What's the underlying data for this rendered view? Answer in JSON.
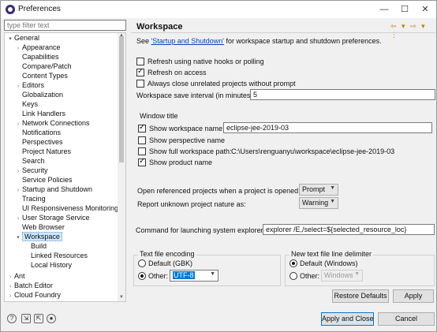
{
  "window": {
    "title": "Preferences",
    "minimize": "—",
    "maximize": "☐",
    "close": "✕"
  },
  "filter": {
    "placeholder": "type filter text"
  },
  "tree": {
    "items": [
      {
        "label": "General",
        "arrow": "▾"
      },
      {
        "label": "Appearance",
        "arrow": "›"
      },
      {
        "label": "Capabilities",
        "arrow": ""
      },
      {
        "label": "Compare/Patch",
        "arrow": ""
      },
      {
        "label": "Content Types",
        "arrow": ""
      },
      {
        "label": "Editors",
        "arrow": "›"
      },
      {
        "label": "Globalization",
        "arrow": ""
      },
      {
        "label": "Keys",
        "arrow": ""
      },
      {
        "label": "Link Handlers",
        "arrow": ""
      },
      {
        "label": "Network Connections",
        "arrow": "›"
      },
      {
        "label": "Notifications",
        "arrow": ""
      },
      {
        "label": "Perspectives",
        "arrow": ""
      },
      {
        "label": "Project Natures",
        "arrow": ""
      },
      {
        "label": "Search",
        "arrow": ""
      },
      {
        "label": "Security",
        "arrow": "›"
      },
      {
        "label": "Service Policies",
        "arrow": ""
      },
      {
        "label": "Startup and Shutdown",
        "arrow": "›"
      },
      {
        "label": "Tracing",
        "arrow": ""
      },
      {
        "label": "UI Responsiveness Monitoring",
        "arrow": ""
      },
      {
        "label": "User Storage Service",
        "arrow": "›"
      },
      {
        "label": "Web Browser",
        "arrow": ""
      },
      {
        "label": "Workspace",
        "arrow": "▾"
      },
      {
        "label": "Build",
        "arrow": ""
      },
      {
        "label": "Linked Resources",
        "arrow": ""
      },
      {
        "label": "Local History",
        "arrow": ""
      },
      {
        "label": "Ant",
        "arrow": "›"
      },
      {
        "label": "Batch Editor",
        "arrow": "›"
      },
      {
        "label": "Cloud Foundry",
        "arrow": "›"
      }
    ]
  },
  "page": {
    "title": "Workspace",
    "nav_arrows": "⇦ ▾ ⇨ ▾ ⋮",
    "intro_prefix": "See ",
    "intro_link": "'Startup and Shutdown'",
    "intro_suffix": " for workspace startup and shutdown preferences.",
    "refresh_native": "Refresh using native hooks or polling",
    "refresh_access": "Refresh on access",
    "close_unrelated": "Always close unrelated projects without prompt",
    "save_interval_label": "Workspace save interval (in minutes):",
    "save_interval_value": "5",
    "window_title_group": "Window title",
    "show_ws_name": "Show workspace name:",
    "ws_name_value": "eclipse-jee-2019-03",
    "show_perspective": "Show perspective name",
    "show_full_path": "Show full workspace path:",
    "full_path_value": "C:\\Users\\renguanyu\\workspace\\eclipse-jee-2019-03",
    "show_product": "Show product name",
    "open_ref_label": "Open referenced projects when a project is opened:",
    "open_ref_value": "Prompt",
    "unknown_nature_label": "Report unknown project nature as:",
    "unknown_nature_value": "Warning",
    "sys_explorer_label": "Command for launching system explorer:",
    "sys_explorer_value": "explorer /E,/select=${selected_resource_loc}",
    "encoding_group": "Text file encoding",
    "encoding_default": "Default (GBK)",
    "encoding_other": "Other:",
    "encoding_value": "UTF-8",
    "delimiter_group": "New text file line delimiter",
    "delimiter_default": "Default (Windows)",
    "delimiter_other": "Other:",
    "delimiter_value": "Windows"
  },
  "buttons": {
    "restore_defaults": "Restore Defaults",
    "apply": "Apply",
    "apply_close": "Apply and Close",
    "cancel": "Cancel"
  },
  "bottom_icons": {
    "help": "?",
    "import": "⇲",
    "export": "⇱",
    "record": "●"
  },
  "colors": {
    "selection": "#cce8ff",
    "link": "#0645ad",
    "default_button_border": "#0078d7"
  }
}
